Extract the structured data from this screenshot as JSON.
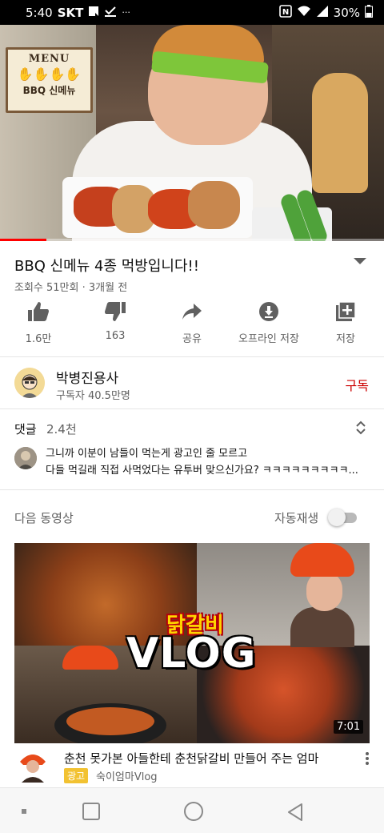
{
  "status_bar": {
    "time": "5:40",
    "carrier": "SKT",
    "battery": "30%"
  },
  "video": {
    "overlay_sign": {
      "title": "MENU",
      "subtitle": "BBQ 신메뉴"
    },
    "progress_fraction": 0.12
  },
  "title": "BBQ 신메뉴 4종 먹방입니다!!",
  "meta": "조회수 51만회 · 3개월 전",
  "actions": [
    {
      "icon": "thumb-up-icon",
      "label": "1.6만"
    },
    {
      "icon": "thumb-down-icon",
      "label": "163"
    },
    {
      "icon": "share-icon",
      "label": "공유"
    },
    {
      "icon": "download-icon",
      "label": "오프라인 저장"
    },
    {
      "icon": "add-to-playlist-icon",
      "label": "저장"
    }
  ],
  "channel": {
    "name": "박병진용사",
    "subscribers": "구독자 40.5만명",
    "subscribe_label": "구독"
  },
  "comments": {
    "label": "댓글",
    "count": "2.4천",
    "top_comment_line1": "그니까 이분이 남들이 먹는게 광고인 줄 모르고",
    "top_comment_line2": "다들 먹길래 직접 사먹었다는 유투버 맞으신가요? ㅋㅋㅋㅋㅋㅋㅋㅋㅋ..."
  },
  "up_next": {
    "label": "다음 동영상",
    "autoplay_label": "자동재생",
    "autoplay_on": false
  },
  "recommendation": {
    "thumbnail_text_top": "닭갈비",
    "thumbnail_text_main": "VLOG",
    "duration": "7:01",
    "title": "춘천 못가본 아들한테 춘천닭갈비 만들어 주는 엄마",
    "ad_label": "광고",
    "channel": "숙이엄마Vlog"
  },
  "colors": {
    "subscribe": "#cc0000",
    "progress": "#ff0000",
    "ad_badge": "#f2c232"
  }
}
